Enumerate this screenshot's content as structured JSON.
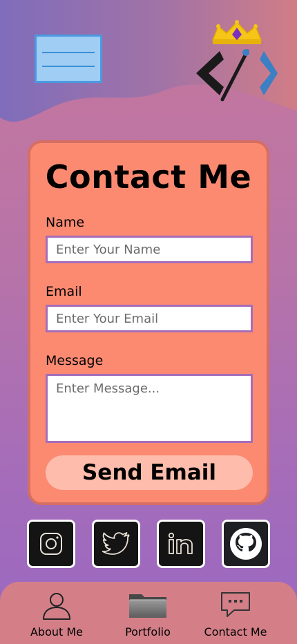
{
  "header": {
    "menu_icon": "menu-icon",
    "logo_icon": "code-brush-crown-logo"
  },
  "contact_form": {
    "title": "Contact Me",
    "name_label": "Name",
    "name_placeholder": "Enter Your Name",
    "name_value": "",
    "email_label": "Email",
    "email_placeholder": "Enter Your Email",
    "email_value": "",
    "message_label": "Message",
    "message_placeholder": "Enter Message...",
    "message_value": "",
    "send_label": "Send Email"
  },
  "social": [
    {
      "icon": "instagram-icon"
    },
    {
      "icon": "twitter-icon"
    },
    {
      "icon": "linkedin-icon"
    },
    {
      "icon": "github-icon"
    }
  ],
  "nav": {
    "items": [
      {
        "label": "About Me",
        "icon": "user-icon"
      },
      {
        "label": "Portfolio",
        "icon": "folder-icon"
      },
      {
        "label": "Contact Me",
        "icon": "chat-icon"
      }
    ]
  },
  "colors": {
    "card_bg": "#fb8a71",
    "card_border": "#d66e63",
    "send_button": "#fdbcac",
    "field_border": "#a56dba",
    "nav_bg": "#d47f88",
    "menu_bg": "#9fcdf3"
  }
}
